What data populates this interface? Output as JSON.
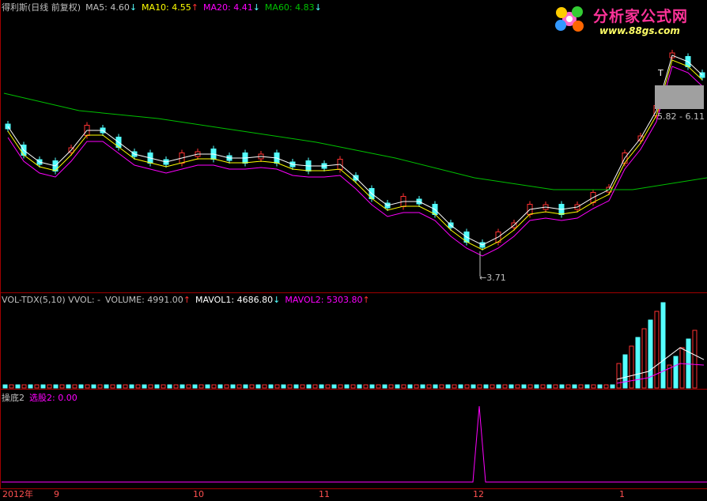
{
  "main": {
    "title": "得利斯(日线 前复权)",
    "ma5_label": "MA5:",
    "ma5_value": "4.60",
    "ma5_arrow": "↓",
    "ma10_label": "MA10:",
    "ma10_value": "4.55",
    "ma10_arrow": "↑",
    "ma20_label": "MA20:",
    "ma20_value": "4.41",
    "ma20_arrow": "↓",
    "ma60_label": "MA60:",
    "ma60_value": "4.83",
    "ma60_arrow": "↓",
    "low_marker": "←3.71",
    "range_label": "5.82 - 6.11",
    "t_marker": "T"
  },
  "volume": {
    "label": "VOL-TDX(5,10) VVOL: -",
    "volume_label": "VOLUME:",
    "volume_value": "4991.00",
    "volume_arrow": "↑",
    "mavol1_label": "MAVOL1:",
    "mavol1_value": "4686.80",
    "mavol1_arrow": "↓",
    "mavol2_label": "MAVOL2:",
    "mavol2_value": "5303.80",
    "mavol2_arrow": "↑"
  },
  "indicator": {
    "label": "操底2",
    "value_label": "选股2:",
    "value": "0.00"
  },
  "axis": {
    "ticks": [
      "2012年",
      "9",
      "10",
      "11",
      "12",
      "1"
    ]
  },
  "logo": {
    "title": "分析家公式网",
    "url": "www.88gs.com"
  },
  "colors": {
    "up": "#ff3232",
    "down": "#54ffff",
    "ma5": "#ffffff",
    "ma10": "#ffff00",
    "ma20": "#ff00ff",
    "ma60": "#00c000"
  },
  "chart_data": {
    "type": "candlestick",
    "title": "得利斯(日线 前复权)",
    "x_ticks": [
      "2012年",
      "9",
      "10",
      "11",
      "12",
      "1"
    ],
    "price_markers": {
      "low": 3.71,
      "range_low": 5.82,
      "range_high": 6.11
    },
    "ma": {
      "MA5": 4.6,
      "MA10": 4.55,
      "MA20": 4.41,
      "MA60": 4.83
    },
    "volume": {
      "VOLUME": 4991.0,
      "MAVOL1": 4686.8,
      "MAVOL2": 5303.8
    },
    "indicator": {
      "选股2": 0.0
    }
  }
}
